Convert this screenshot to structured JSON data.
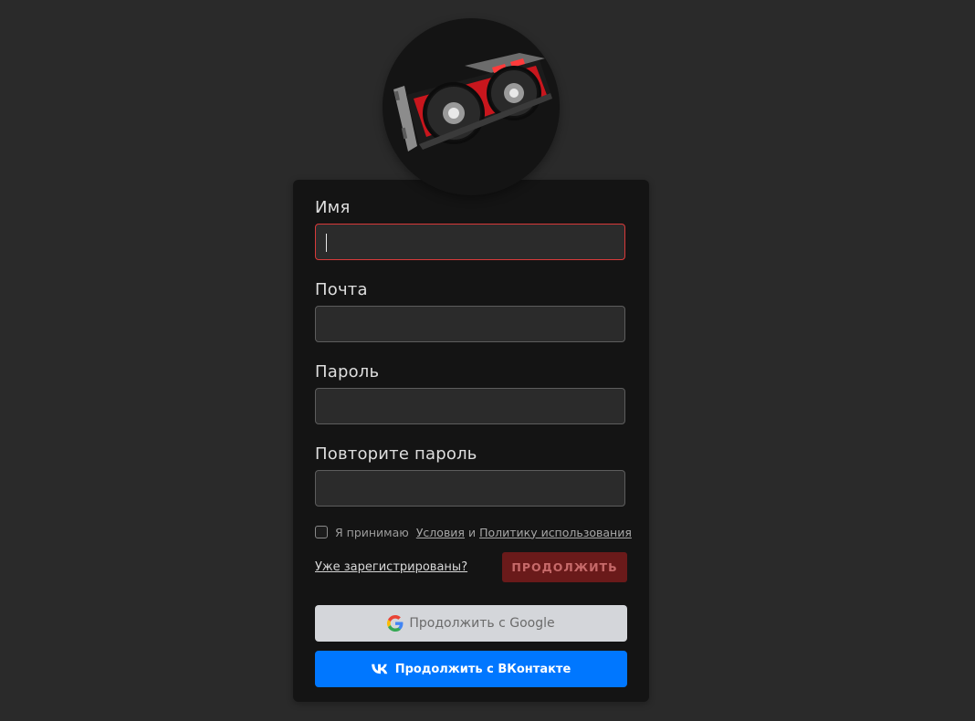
{
  "form": {
    "name_label": "Имя",
    "name_value": "",
    "email_label": "Почта",
    "email_value": "",
    "password_label": "Пароль",
    "password_value": "",
    "repeat_password_label": "Повторите пароль",
    "repeat_password_value": ""
  },
  "terms": {
    "checked": false,
    "prefix": "Я принимаю",
    "terms_link": "Условия",
    "conjunction": "и",
    "policy_link": "Политику использования"
  },
  "actions": {
    "already_registered": "Уже зарегистрированы?",
    "continue_label": "ПРОДОЛЖИТЬ",
    "google_label": "Продолжить с Google",
    "vk_label": "Продолжить с ВКонтакте"
  },
  "logo": {
    "icon": "graphics-card-image"
  },
  "colors": {
    "background": "#2a2a2a",
    "card": "#141414",
    "input_bg": "#2b2b2b",
    "active_border": "#d93a3a",
    "continue_bg": "#6a1a1a",
    "google_bg": "#d4d6da",
    "vk_bg": "#0077ff"
  }
}
